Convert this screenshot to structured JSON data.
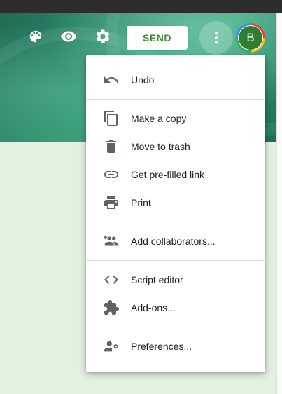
{
  "header": {
    "send_label": "SEND",
    "avatar_initial": "B",
    "icons": [
      "palette-icon",
      "eye-icon",
      "gear-icon",
      "more-vert-icon"
    ]
  },
  "menu": {
    "items": [
      {
        "label": "Undo",
        "icon": "undo-icon"
      },
      {
        "label": "Make a copy",
        "icon": "copy-icon"
      },
      {
        "label": "Move to trash",
        "icon": "trash-icon"
      },
      {
        "label": "Get pre-filled link",
        "icon": "link-icon"
      },
      {
        "label": "Print",
        "icon": "print-icon"
      },
      {
        "label": "Add collaborators...",
        "icon": "add-people-icon"
      },
      {
        "label": "Script editor",
        "icon": "code-icon"
      },
      {
        "label": "Add-ons...",
        "icon": "puzzle-icon"
      },
      {
        "label": "Preferences...",
        "icon": "person-settings-icon"
      }
    ]
  },
  "colors": {
    "header_green": "#2d8c6c",
    "send_text": "#3d8b37",
    "page_background": "#e3f1e1",
    "icon_gray": "#5f6368"
  }
}
